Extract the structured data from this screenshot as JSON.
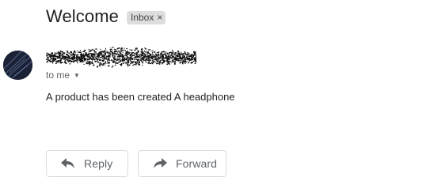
{
  "subject": "Welcome",
  "label": {
    "name": "Inbox",
    "remove_glyph": "×"
  },
  "recipient": {
    "text": "to me"
  },
  "body": "A product has been created A headphone",
  "actions": {
    "reply": "Reply",
    "forward": "Forward"
  },
  "icons": {
    "reply": "reply-arrow-icon",
    "forward": "forward-arrow-icon",
    "caret": "caret-down-icon"
  },
  "colors": {
    "text": "#202124",
    "muted": "#5f6368",
    "chip": "#dddddd",
    "border": "#dadce0"
  }
}
